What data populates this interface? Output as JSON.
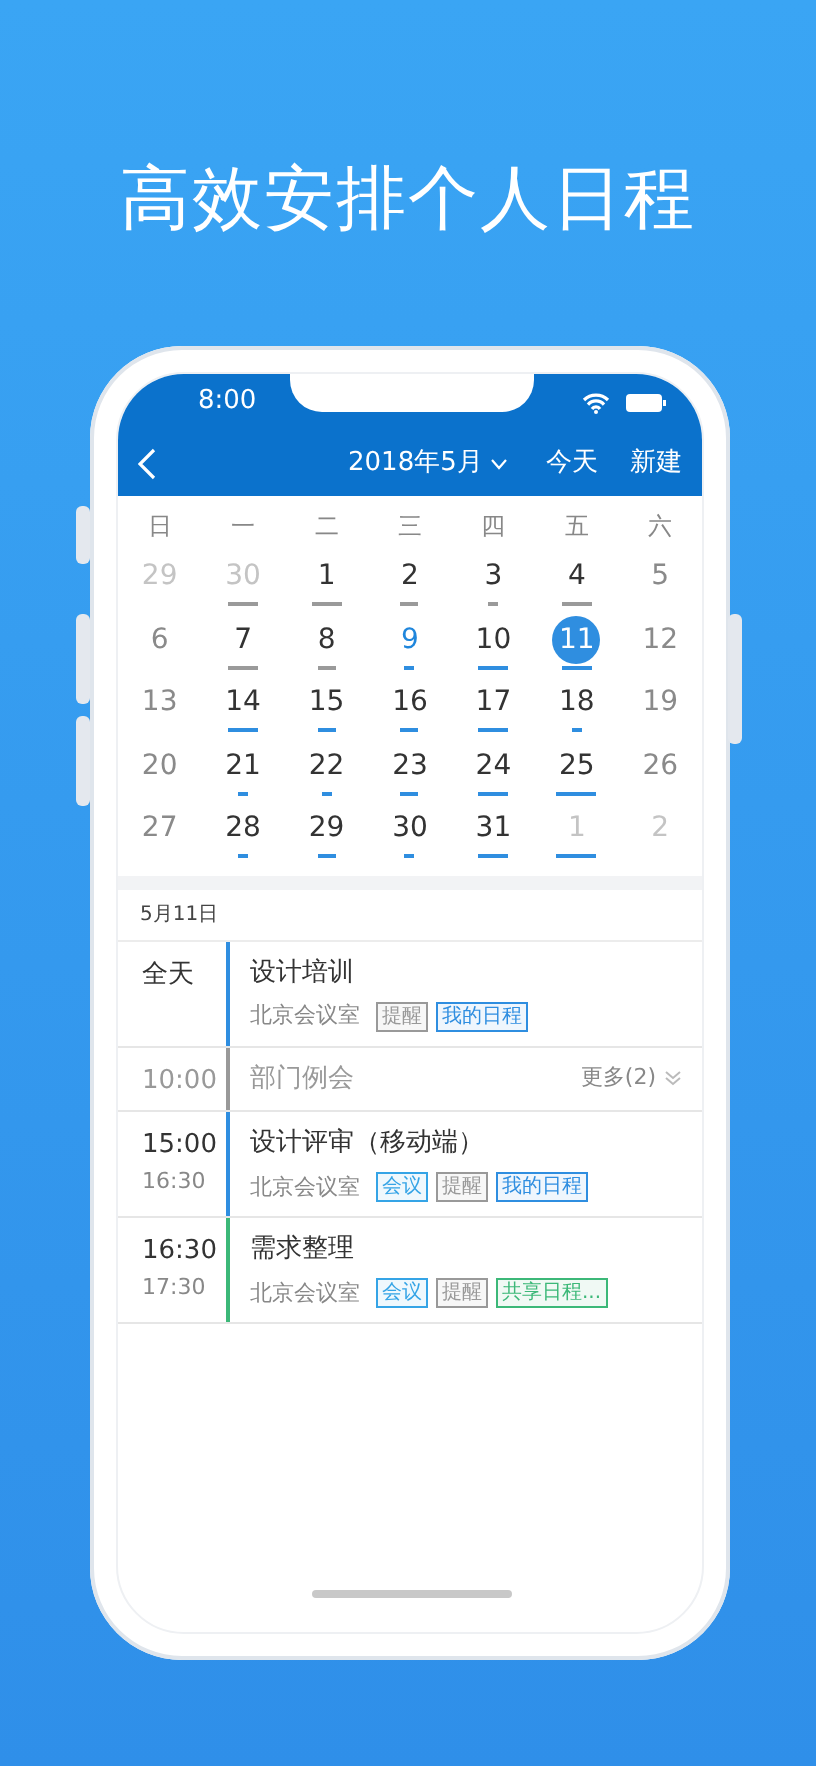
{
  "headline": "高效安排个人日程",
  "status_bar": {
    "time": "8:00"
  },
  "nav": {
    "title": "2018年5月",
    "today": "今天",
    "new": "新建"
  },
  "weekdays": [
    "日",
    "一",
    "二",
    "三",
    "四",
    "五",
    "六"
  ],
  "days": [
    {
      "label": "29",
      "kind": "other",
      "selected": false
    },
    {
      "label": "30",
      "kind": "other",
      "selected": false,
      "marker": {
        "kind": "long",
        "color": "#9a9a9a"
      }
    },
    {
      "label": "1",
      "kind": "weekday",
      "selected": false,
      "marker": {
        "kind": "long",
        "color": "#9a9a9a"
      }
    },
    {
      "label": "2",
      "kind": "weekday",
      "selected": false,
      "marker": {
        "kind": "medium",
        "color": "#9a9a9a"
      }
    },
    {
      "label": "3",
      "kind": "weekday",
      "selected": false,
      "marker": {
        "kind": "short",
        "color": "#9a9a9a"
      }
    },
    {
      "label": "4",
      "kind": "weekday",
      "selected": false,
      "marker": {
        "kind": "long",
        "color": "#9a9a9a"
      }
    },
    {
      "label": "5",
      "kind": "weekend",
      "selected": false
    },
    {
      "label": "6",
      "kind": "weekend",
      "selected": false
    },
    {
      "label": "7",
      "kind": "weekday",
      "selected": false,
      "marker": {
        "kind": "long",
        "color": "#9a9a9a"
      }
    },
    {
      "label": "8",
      "kind": "weekday",
      "selected": false,
      "marker": {
        "kind": "medium",
        "color": "#9a9a9a"
      }
    },
    {
      "label": "9",
      "kind": "today",
      "selected": false,
      "marker": {
        "kind": "short",
        "color": "#2f8ee0"
      }
    },
    {
      "label": "10",
      "kind": "weekday",
      "selected": false,
      "marker": {
        "kind": "long",
        "color": "#2f8ee0"
      }
    },
    {
      "label": "11",
      "kind": "weekday",
      "selected": true,
      "marker": {
        "kind": "long",
        "color": "#2f8ee0"
      }
    },
    {
      "label": "12",
      "kind": "weekend",
      "selected": false
    },
    {
      "label": "13",
      "kind": "weekend",
      "selected": false
    },
    {
      "label": "14",
      "kind": "weekday",
      "selected": false,
      "marker": {
        "kind": "long",
        "color": "#2f8ee0"
      }
    },
    {
      "label": "15",
      "kind": "weekday",
      "selected": false,
      "marker": {
        "kind": "medium",
        "color": "#2f8ee0"
      }
    },
    {
      "label": "16",
      "kind": "weekday",
      "selected": false,
      "marker": {
        "kind": "medium",
        "color": "#2f8ee0"
      }
    },
    {
      "label": "17",
      "kind": "weekday",
      "selected": false,
      "marker": {
        "kind": "long",
        "color": "#2f8ee0"
      }
    },
    {
      "label": "18",
      "kind": "weekday",
      "selected": false,
      "marker": {
        "kind": "short",
        "color": "#2f8ee0"
      }
    },
    {
      "label": "19",
      "kind": "weekend",
      "selected": false
    },
    {
      "label": "20",
      "kind": "weekend",
      "selected": false
    },
    {
      "label": "21",
      "kind": "weekday",
      "selected": false,
      "marker": {
        "kind": "short",
        "color": "#2f8ee0"
      }
    },
    {
      "label": "22",
      "kind": "weekday",
      "selected": false,
      "marker": {
        "kind": "short",
        "color": "#2f8ee0"
      }
    },
    {
      "label": "23",
      "kind": "weekday",
      "selected": false,
      "marker": {
        "kind": "medium",
        "color": "#2f8ee0"
      }
    },
    {
      "label": "24",
      "kind": "weekday",
      "selected": false,
      "marker": {
        "kind": "long",
        "color": "#2f8ee0"
      }
    },
    {
      "label": "25",
      "kind": "weekday",
      "selected": false,
      "marker": {
        "kind": "wide",
        "color": "#2f8ee0"
      }
    },
    {
      "label": "26",
      "kind": "weekend",
      "selected": false
    },
    {
      "label": "27",
      "kind": "weekend",
      "selected": false
    },
    {
      "label": "28",
      "kind": "weekday",
      "selected": false,
      "marker": {
        "kind": "short",
        "color": "#2f8ee0"
      }
    },
    {
      "label": "29",
      "kind": "weekday",
      "selected": false,
      "marker": {
        "kind": "medium",
        "color": "#2f8ee0"
      }
    },
    {
      "label": "30",
      "kind": "weekday",
      "selected": false,
      "marker": {
        "kind": "short",
        "color": "#2f8ee0"
      }
    },
    {
      "label": "31",
      "kind": "weekday",
      "selected": false,
      "marker": {
        "kind": "long",
        "color": "#2f8ee0"
      }
    },
    {
      "label": "1",
      "kind": "other",
      "selected": false,
      "marker": {
        "kind": "wide",
        "color": "#2f8ee0"
      }
    },
    {
      "label": "2",
      "kind": "other",
      "selected": false
    }
  ],
  "agenda_date": "5月11日",
  "events": [
    {
      "start": "全天",
      "title": "设计培训",
      "location": "北京会议室",
      "color": "#2f8ee0",
      "muted": false,
      "tags": [
        {
          "text": "提醒",
          "color": "#999999"
        },
        {
          "text": "我的日程",
          "color": "#2f8ee0"
        }
      ]
    },
    {
      "start": "10:00",
      "title": "部门例会",
      "color": "#999999",
      "muted": true,
      "more": "更多(2)"
    },
    {
      "start": "15:00",
      "end": "16:30",
      "title": "设计评审（移动端）",
      "location": "北京会议室",
      "color": "#2f8ee0",
      "muted": false,
      "tags": [
        {
          "text": "会议",
          "color": "#35a4e6"
        },
        {
          "text": "提醒",
          "color": "#999999"
        },
        {
          "text": "我的日程",
          "color": "#2f8ee0"
        }
      ]
    },
    {
      "start": "16:30",
      "end": "17:30",
      "title": "需求整理",
      "location": "北京会议室",
      "color": "#3cb878",
      "muted": false,
      "tags": [
        {
          "text": "会议",
          "color": "#35a4e6"
        },
        {
          "text": "提醒",
          "color": "#999999"
        },
        {
          "text": "共享日程...",
          "color": "#3cb878"
        }
      ]
    }
  ]
}
